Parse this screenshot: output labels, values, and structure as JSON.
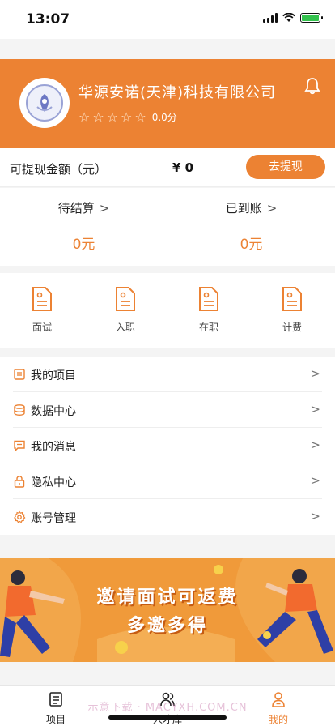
{
  "status_bar": {
    "time": "13:07"
  },
  "header": {
    "company_name": "华源安诺(天津)科技有限公司",
    "stars": [
      "☆",
      "☆",
      "☆",
      "☆",
      "☆"
    ],
    "rating_score": "0.0分"
  },
  "withdraw": {
    "label": "可提现金额（元）",
    "amount": "¥ 0",
    "button_label": "去提现"
  },
  "settlement": {
    "pending": {
      "title": "待结算",
      "value": "0元"
    },
    "received": {
      "title": "已到账",
      "value": "0元"
    }
  },
  "shortcuts": [
    {
      "label": "面试"
    },
    {
      "label": "入职"
    },
    {
      "label": "在职"
    },
    {
      "label": "计费"
    }
  ],
  "menu": [
    {
      "label": "我的项目",
      "icon": "project-icon"
    },
    {
      "label": "数据中心",
      "icon": "database-icon"
    },
    {
      "label": "我的消息",
      "icon": "message-icon"
    },
    {
      "label": "隐私中心",
      "icon": "lock-icon"
    },
    {
      "label": "账号管理",
      "icon": "settings-icon"
    }
  ],
  "banner": {
    "line1": "邀请面试可返费",
    "line2": "多邀多得"
  },
  "tabbar": [
    {
      "label": "项目",
      "icon": "project-tab-icon"
    },
    {
      "label": "人才库",
      "icon": "talent-tab-icon"
    },
    {
      "label": "我的",
      "icon": "profile-tab-icon"
    }
  ],
  "watermark": "示意下载 · MACYXH.COM.CN",
  "colors": {
    "accent": "#ec8233",
    "background": "#f4f4f4"
  }
}
